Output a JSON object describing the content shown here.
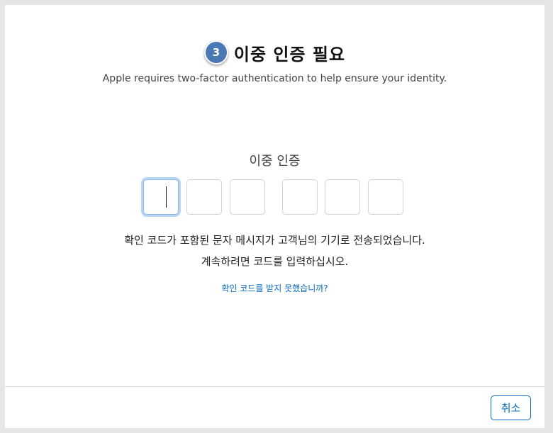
{
  "header": {
    "step_number": "3",
    "title": "이중 인증 필요",
    "subtitle": "Apple requires two-factor authentication to help ensure your identity."
  },
  "verification": {
    "label": "이중 인증",
    "code_digits": [
      "",
      "",
      "",
      "",
      "",
      ""
    ],
    "message_line1": "확인 코드가 포함된 문자 메시지가 고객님의 기기로 전송되었습니다.",
    "message_line2": "계속하려면 코드를 입력하십시오.",
    "resend_link": "확인 코드를 받지 못했습니까?"
  },
  "footer": {
    "cancel_label": "취소"
  },
  "colors": {
    "accent": "#0b6bc4",
    "step_badge": "#4a78b5",
    "focus_ring": "#b9d6f5"
  }
}
